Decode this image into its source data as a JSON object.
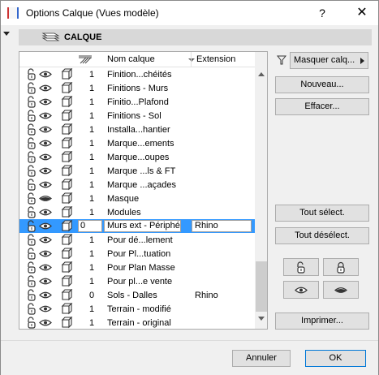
{
  "window": {
    "title": "Options Calque (Vues modèle)",
    "help_label": "?",
    "close_label": "✕"
  },
  "section": {
    "title": "CALQUE"
  },
  "table": {
    "headers": {
      "name": "Nom calque",
      "extension": "Extension"
    },
    "rows": [
      {
        "lock": "unlocked",
        "visibility": "shown",
        "num": "1",
        "name": "Finition...chéités",
        "ext": ""
      },
      {
        "lock": "unlocked",
        "visibility": "shown",
        "num": "1",
        "name": "Finitions - Murs",
        "ext": ""
      },
      {
        "lock": "unlocked",
        "visibility": "shown",
        "num": "1",
        "name": "Finitio...Plafond",
        "ext": ""
      },
      {
        "lock": "unlocked",
        "visibility": "shown",
        "num": "1",
        "name": "Finitions - Sol",
        "ext": ""
      },
      {
        "lock": "unlocked",
        "visibility": "shown",
        "num": "1",
        "name": "Installa...hantier",
        "ext": ""
      },
      {
        "lock": "unlocked",
        "visibility": "shown",
        "num": "1",
        "name": "Marque...ements",
        "ext": ""
      },
      {
        "lock": "unlocked",
        "visibility": "shown",
        "num": "1",
        "name": "Marque...oupes",
        "ext": ""
      },
      {
        "lock": "unlocked",
        "visibility": "shown",
        "num": "1",
        "name": "Marque ...ls & FT",
        "ext": ""
      },
      {
        "lock": "unlocked",
        "visibility": "shown",
        "num": "1",
        "name": "Marque ...açades",
        "ext": ""
      },
      {
        "lock": "unlocked",
        "visibility": "hidden",
        "num": "1",
        "name": "Masque",
        "ext": ""
      },
      {
        "lock": "unlocked",
        "visibility": "shown",
        "num": "1",
        "name": "Modules",
        "ext": ""
      },
      {
        "lock": "unlocked",
        "visibility": "shown",
        "num": "0",
        "name": "Murs ext - Périphé",
        "ext": "Rhino",
        "selected": true
      },
      {
        "lock": "unlocked",
        "visibility": "shown",
        "num": "1",
        "name": "Pour dé...lement",
        "ext": ""
      },
      {
        "lock": "unlocked",
        "visibility": "shown",
        "num": "1",
        "name": "Pour Pl...tuation",
        "ext": ""
      },
      {
        "lock": "unlocked",
        "visibility": "shown",
        "num": "1",
        "name": "Pour Plan Masse",
        "ext": ""
      },
      {
        "lock": "unlocked",
        "visibility": "shown",
        "num": "1",
        "name": "Pour pl...e vente",
        "ext": ""
      },
      {
        "lock": "unlocked",
        "visibility": "shown",
        "num": "0",
        "name": "Sols - Dalles",
        "ext": "Rhino"
      },
      {
        "lock": "unlocked",
        "visibility": "shown",
        "num": "1",
        "name": "Terrain - modifié",
        "ext": ""
      },
      {
        "lock": "unlocked",
        "visibility": "shown",
        "num": "1",
        "name": "Terrain - original",
        "ext": ""
      }
    ]
  },
  "sidebar": {
    "filter_label": "Masquer calq...",
    "new_label": "Nouveau...",
    "delete_label": "Effacer...",
    "select_all_label": "Tout sélect.",
    "deselect_all_label": "Tout désélect.",
    "print_label": "Imprimer..."
  },
  "footer": {
    "cancel_label": "Annuler",
    "ok_label": "OK"
  },
  "colors": {
    "selection": "#3399ff",
    "default_button_border": "#0078d7"
  }
}
